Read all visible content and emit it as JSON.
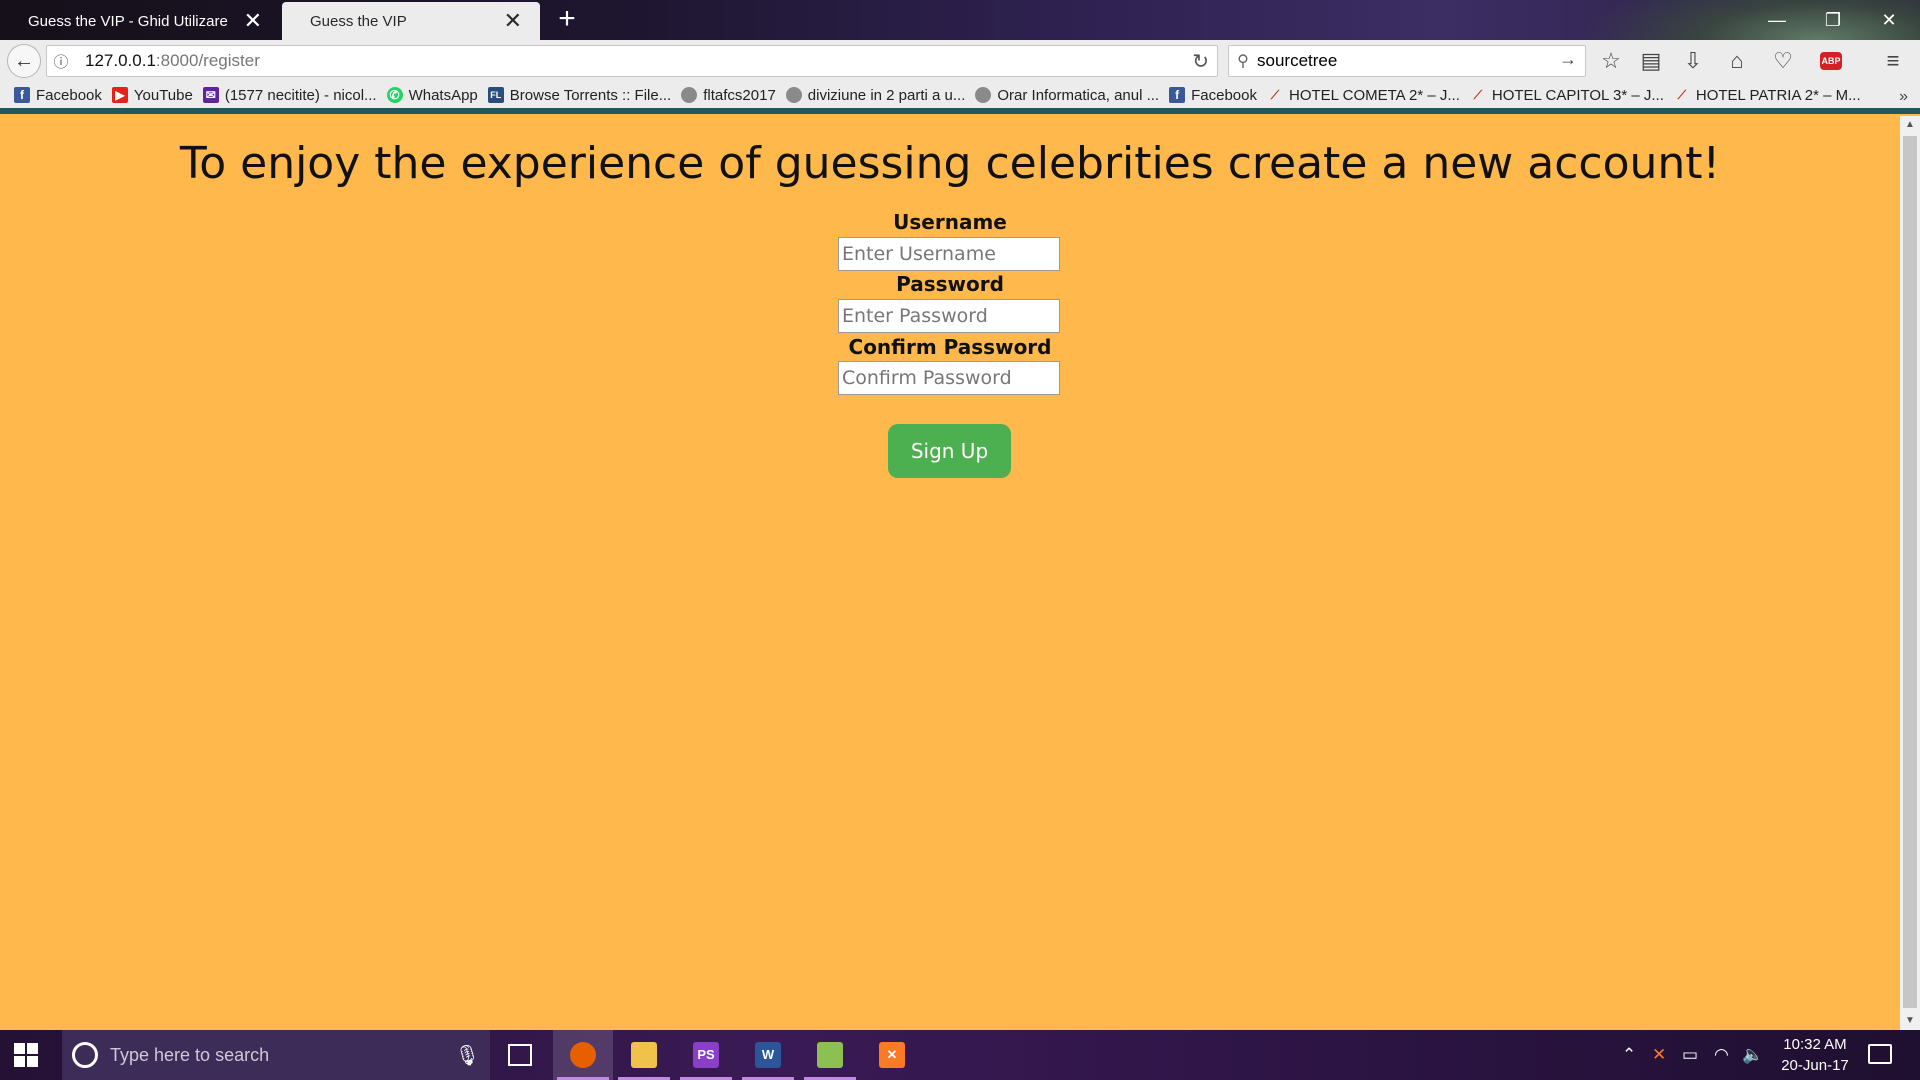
{
  "browser": {
    "tabs": [
      {
        "title": "Guess the VIP - Ghid Utilizare",
        "active": false
      },
      {
        "title": "Guess the VIP",
        "active": true
      }
    ],
    "url_host": "127.0.0.1",
    "url_path": ":8000/register",
    "search_value": "sourcetree",
    "bookmarks": [
      {
        "label": "Facebook",
        "icon": "facebook-icon",
        "color": "#3b5998"
      },
      {
        "label": "YouTube",
        "icon": "youtube-icon",
        "color": "#e62117"
      },
      {
        "label": "(1577 necitite) - nicol...",
        "icon": "mail-icon",
        "color": "#5f259f"
      },
      {
        "label": "WhatsApp",
        "icon": "whatsapp-icon",
        "color": "#25d366"
      },
      {
        "label": "Browse Torrents :: File...",
        "icon": "filelist-icon",
        "color": "#2a4d7a"
      },
      {
        "label": "fltafcs2017",
        "icon": "globe-icon",
        "color": "#8a8a8a"
      },
      {
        "label": "diviziune in 2 parti a u...",
        "icon": "globe-icon",
        "color": "#8a8a8a"
      },
      {
        "label": "Orar Informatica, anul ...",
        "icon": "globe-icon",
        "color": "#8a8a8a"
      },
      {
        "label": "Facebook",
        "icon": "facebook-icon",
        "color": "#3b5998"
      },
      {
        "label": "HOTEL COMETA 2* – J...",
        "icon": "hotel-icon",
        "color": "#c0392b"
      },
      {
        "label": "HOTEL CAPITOL 3* – J...",
        "icon": "hotel-icon",
        "color": "#c0392b"
      },
      {
        "label": "HOTEL PATRIA 2* – M...",
        "icon": "hotel-icon",
        "color": "#c0392b"
      }
    ]
  },
  "page": {
    "heading": "To enjoy the experience of guessing celebrities create a new account!",
    "username_label": "Username",
    "username_placeholder": "Enter Username",
    "password_label": "Password",
    "password_placeholder": "Enter Password",
    "confirm_label": "Confirm Password",
    "confirm_placeholder": "Confirm Password",
    "signup_label": "Sign Up",
    "background_color": "#ffb84c",
    "button_color": "#4caf50"
  },
  "taskbar": {
    "search_placeholder": "Type here to search",
    "apps": [
      {
        "name": "firefox",
        "glyph": "",
        "color": "#e66000",
        "active": true
      },
      {
        "name": "file-explorer",
        "glyph": "",
        "color": "#f0c24b",
        "active": false
      },
      {
        "name": "phpstorm",
        "glyph": "PS",
        "color": "#8b3fc9",
        "active": false
      },
      {
        "name": "word",
        "glyph": "W",
        "color": "#2b579a",
        "active": false
      },
      {
        "name": "notepad-plus-plus",
        "glyph": "",
        "color": "#8cc152",
        "active": false
      },
      {
        "name": "xampp",
        "glyph": "✕",
        "color": "#fb7a24",
        "active": false
      }
    ],
    "time": "10:32 AM",
    "date": "20-Jun-17"
  }
}
